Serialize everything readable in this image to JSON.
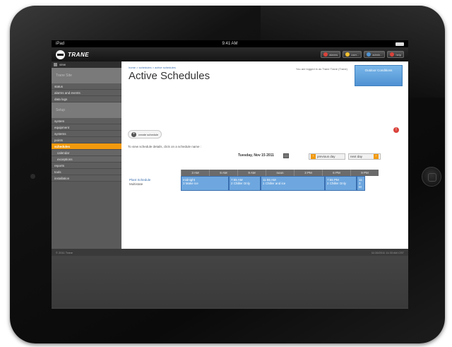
{
  "status": {
    "carrier": "iPad",
    "time": "9:41 AM"
  },
  "brand": {
    "name": "TRANE"
  },
  "top_actions": [
    {
      "label": "alarms",
      "color": "#d9423a"
    },
    {
      "label": "user...",
      "color": "#f2c12e"
    },
    {
      "label": "admin...",
      "color": "#4f92d2"
    },
    {
      "label": "help",
      "color": "#d9423a"
    }
  ],
  "sidebar": {
    "header": "view",
    "block_label": "Trane Site",
    "items_a": [
      "status",
      "alarms and events",
      "data logs"
    ],
    "block_label_b": "Setup",
    "items_b": [
      "system",
      "equipment",
      "systems",
      "points"
    ],
    "active": "schedules",
    "sub_items": [
      "calendar",
      "exceptions"
    ],
    "items_c": [
      "reports",
      "tools",
      "installation"
    ]
  },
  "content": {
    "breadcrumb": "home > schedules > active schedules",
    "title": "Active Schedules",
    "logged_in": "You are logged in as Trane Trane (Trane)",
    "outdoor_btn": "Outdoor Conditions",
    "create_label": "create schedule",
    "hint": "To view schedule details, click on a schedule name :",
    "date": "Tuesday, Nov 15 2011",
    "prev_day": "previous day",
    "next_day": "next day"
  },
  "table": {
    "headers": [
      "3 AM",
      "6 AM",
      "9 AM",
      "noon",
      "3 PM",
      "6 PM",
      "9 PM"
    ],
    "row_name": "Plant Schedule",
    "row_sub": "Multistate",
    "segments": [
      {
        "time": "midnight",
        "state": "3 Make ice"
      },
      {
        "time": "7:55 AM",
        "state": "2 Chiller Only"
      },
      {
        "time": "11:55 AM",
        "state": "1 Chiller and ice"
      },
      {
        "time": "7:55 PM",
        "state": "2 Chiller Only"
      },
      {
        "time": "11:",
        "state": "3 M"
      }
    ]
  },
  "footer": {
    "left": "© 2011 Trane",
    "right": "11/15/2011 11:33 AM CST"
  }
}
